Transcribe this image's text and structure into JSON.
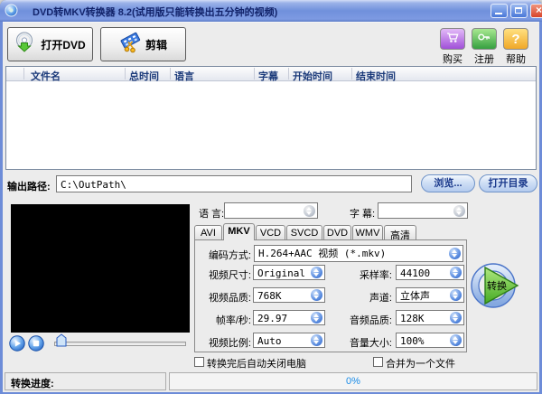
{
  "window": {
    "title": "DVD转MKV转换器 8.2(试用版只能转换出五分钟的视频)"
  },
  "icons": {
    "help_glyph": "?",
    "close_glyph": "×"
  },
  "toolbar": {
    "open_dvd_label": "打开DVD",
    "clip_label": "剪辑",
    "buy_label": "购买",
    "register_label": "注册",
    "help_label": "帮助"
  },
  "file_table": {
    "columns": [
      "文件名",
      "总时间",
      "语言",
      "字幕",
      "开始时间",
      "结束时间"
    ],
    "rows": []
  },
  "output": {
    "label": "输出路径:",
    "path": "C:\\OutPath\\",
    "browse_label": "浏览...",
    "open_dir_label": "打开目录"
  },
  "stream": {
    "language_label": "语 言:",
    "language_value": "",
    "subtitle_label": "字 幕:",
    "subtitle_value": ""
  },
  "format_tabs": {
    "tabs": [
      "AVI",
      "MKV",
      "VCD",
      "SVCD",
      "DVD",
      "WMV",
      "高清"
    ],
    "active": "MKV"
  },
  "settings": {
    "encoding_label": "编码方式:",
    "encoding_value": "H.264+AAC 视频 (*.mkv)",
    "left": [
      {
        "label": "视频尺寸:",
        "value": "Original"
      },
      {
        "label": "视频品质:",
        "value": "768K"
      },
      {
        "label": "帧率/秒:",
        "value": "29.97"
      },
      {
        "label": "视频比例:",
        "value": "Auto"
      }
    ],
    "right": [
      {
        "label": "采样率:",
        "value": "44100"
      },
      {
        "label": "声道:",
        "value": "立体声"
      },
      {
        "label": "音频品质:",
        "value": "128K"
      },
      {
        "label": "音量大小:",
        "value": "100%"
      }
    ]
  },
  "options": {
    "shutdown_label": "转换完后自动关闭电脑",
    "shutdown_checked": false,
    "merge_label": "合并为一个文件",
    "merge_checked": false
  },
  "convert_label": "转换",
  "statusbar": {
    "progress_label": "转换进度:",
    "progress_value": "0%"
  },
  "colors": {
    "titlebar_blue": "#6d8cd8",
    "header_text": "#1b3a7a",
    "progress_text": "#1a8ce8",
    "pill_text": "#1b3a8c",
    "convert_green": "#55b830"
  }
}
